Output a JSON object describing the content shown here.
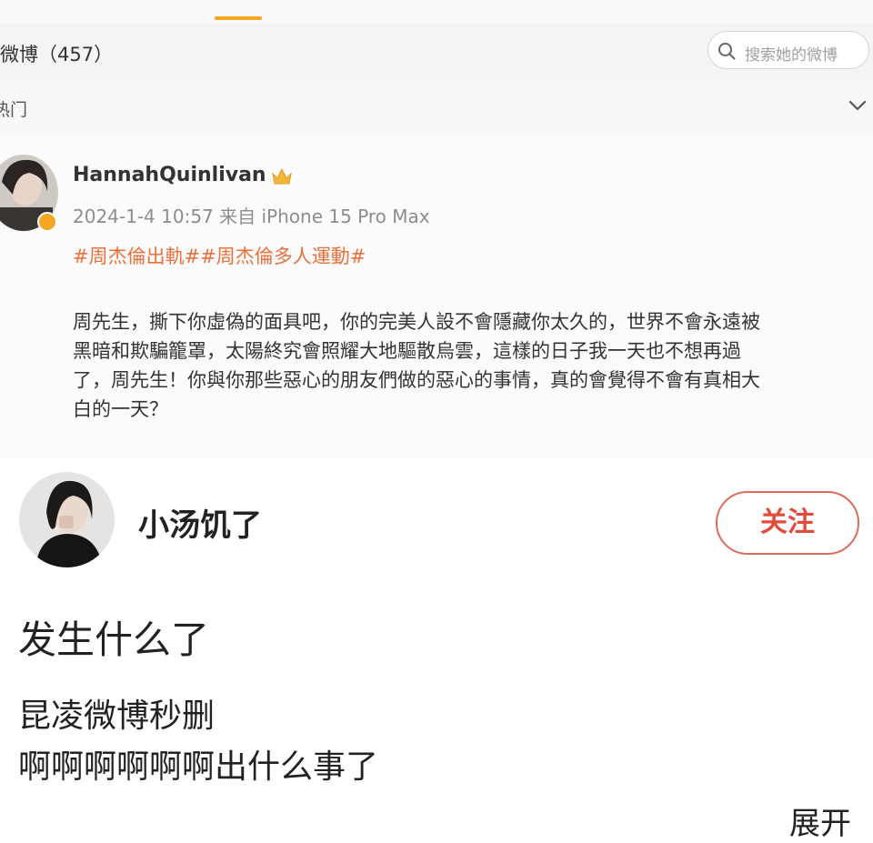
{
  "profile": {
    "weibo_count_label": "微博（457）",
    "search_placeholder": "搜索她的微博",
    "filter_label": "热门"
  },
  "post": {
    "author": "HannahQuinlivan",
    "timestamp": "2024-1-4 10:57",
    "source": "来自 iPhone 15 Pro Max",
    "hashtags": "#周杰倫出軌##周杰倫多人運動#",
    "body_lines": [
      "周先生，撕下你虛偽的面具吧，你的完美人設不會隱藏你太久的，世界不會永遠被",
      "黑暗和欺騙籠罩，太陽終究會照耀大地驅散烏雲，這樣的日子我一天也不想再過",
      "了，周先生！你與你那些惡心的朋友們做的惡心的事情，真的會覺得不會有真相大",
      "白的一天？"
    ]
  },
  "comment": {
    "username": "小汤饥了",
    "follow_label": "关注",
    "lines": [
      "发生什么了",
      "昆凌微博秒删",
      "啊啊啊啊啊啊出什么事了"
    ],
    "expand_label": "展开"
  },
  "colors": {
    "hashtag": "#e8713c",
    "follow": "#e24b3b",
    "badge": "#f5a623"
  },
  "icons": [
    "search-icon",
    "chevron-down-icon",
    "crown-icon",
    "verified-badge-icon"
  ]
}
